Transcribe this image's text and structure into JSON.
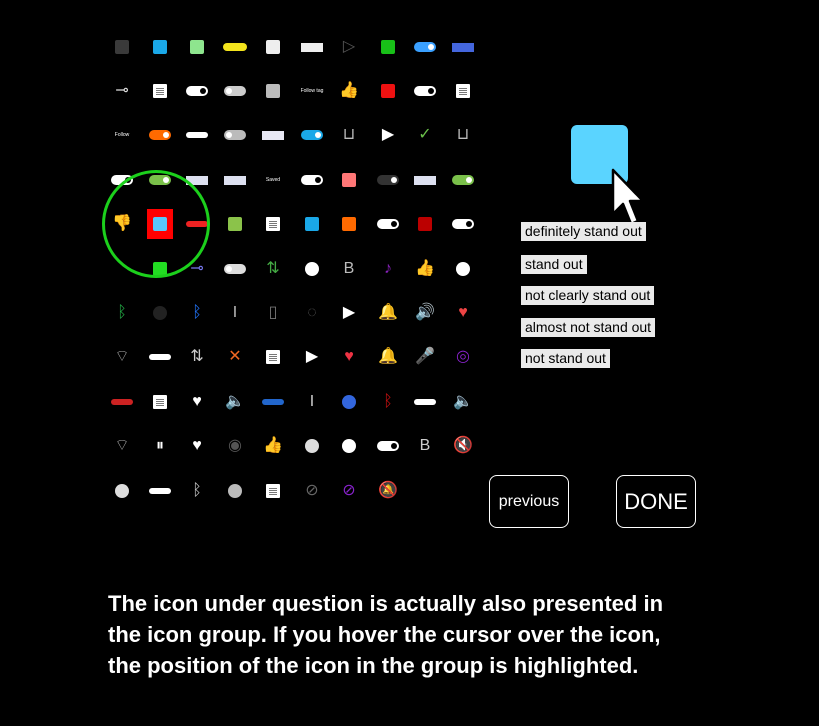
{
  "screen": {
    "target_icon_name": "light-blue-square-icon",
    "options": [
      {
        "label": "definitely stand out"
      },
      {
        "label": "stand out"
      },
      {
        "label": "not clearly stand out"
      },
      {
        "label": "almost not stand out"
      },
      {
        "label": "not stand out"
      }
    ],
    "previous_label": "previous",
    "done_label": "DONE",
    "instructions": [
      "The icon under question is actually also presented in",
      "the icon group. If you hover the cursor over the icon,",
      "the position of the icon in the group is highlighted."
    ],
    "highlight_color": "#1cd01c",
    "highlight_box_color": "#ff0000",
    "target_color": "#5ad4ff"
  },
  "icon_grid": {
    "rows": [
      [
        {
          "name": "dark-gray-square-icon",
          "kind": "sq",
          "color": "#3a3a3a"
        },
        {
          "name": "blue-square-icon",
          "kind": "sq",
          "color": "#1aa8e8"
        },
        {
          "name": "light-green-square-icon",
          "kind": "sq",
          "color": "#8ee58e"
        },
        {
          "name": "yellow-pill-icon",
          "kind": "pill",
          "color": "#f4e41c"
        },
        {
          "name": "white-square-icon",
          "kind": "sq",
          "color": "#eeeeee"
        },
        {
          "name": "white-label-bar-icon",
          "kind": "rect",
          "color": "#eeeeee"
        },
        {
          "name": "play-outline-icon",
          "kind": "glyph",
          "text": "▷",
          "color": "#555555"
        },
        {
          "name": "green-square-icon",
          "kind": "sq",
          "color": "#18c018"
        },
        {
          "name": "blue-toggle-icon",
          "kind": "tog",
          "color": "#3aa0ff",
          "knob": "r"
        },
        {
          "name": "blue-white-bar-icon",
          "kind": "rect",
          "color": "#4466dd"
        }
      ],
      [
        {
          "name": "slider-knob-icon",
          "kind": "glyph",
          "text": "⊸",
          "color": "#dddddd"
        },
        {
          "name": "document-icon",
          "kind": "doc"
        },
        {
          "name": "white-toggle-icon",
          "kind": "tog",
          "color": "#ffffff",
          "knob": "dr"
        },
        {
          "name": "gray-toggle-icon",
          "kind": "tog",
          "color": "#cccccc",
          "knob": "l"
        },
        {
          "name": "gray-square-icon",
          "kind": "sq",
          "color": "#bbbbbb"
        },
        {
          "name": "small-text-label-icon",
          "kind": "text",
          "text": "Follow tag"
        },
        {
          "name": "thumbs-up-icon",
          "kind": "glyph",
          "text": "👍",
          "color": "#ffffff"
        },
        {
          "name": "red-square-icon",
          "kind": "sq",
          "color": "#ee1111"
        },
        {
          "name": "dark-toggle-icon",
          "kind": "tog",
          "color": "#ffffff",
          "knob": "dr"
        },
        {
          "name": "document-icon",
          "kind": "doc"
        }
      ],
      [
        {
          "name": "small-text-label-icon",
          "kind": "text",
          "text": "Follow"
        },
        {
          "name": "orange-toggle-icon",
          "kind": "tog",
          "color": "#ff6a00",
          "knob": "r"
        },
        {
          "name": "white-blue-bar-icon",
          "kind": "btnbar",
          "color": "#ffffff"
        },
        {
          "name": "gray-toggle-icon",
          "kind": "tog",
          "color": "#bbbbbb",
          "knob": "l"
        },
        {
          "name": "white-blue-bar-icon",
          "kind": "rect",
          "color": "#e8e8f4"
        },
        {
          "name": "blue-toggle-icon",
          "kind": "tog",
          "color": "#1aa8e8",
          "knob": "r"
        },
        {
          "name": "u-box-icon",
          "kind": "glyph",
          "text": "⊔",
          "color": "#bbbbbb"
        },
        {
          "name": "play-icon",
          "kind": "glyph",
          "text": "▶",
          "color": "#ffffff"
        },
        {
          "name": "checkmark-icon",
          "kind": "glyph",
          "text": "✓",
          "color": "#6ac04a"
        },
        {
          "name": "u-box-icon",
          "kind": "glyph",
          "text": "⊔",
          "color": "#bbbbbb"
        }
      ],
      [
        {
          "name": "white-toggle-icon",
          "kind": "tog",
          "color": "#ffffff",
          "knob": "dr"
        },
        {
          "name": "green-toggle-icon",
          "kind": "tog",
          "color": "#7ac04a",
          "knob": "r"
        },
        {
          "name": "white-blue-bar-icon",
          "kind": "rect",
          "color": "#dde0f0"
        },
        {
          "name": "white-blue-bar-icon",
          "kind": "rect",
          "color": "#dde0f0"
        },
        {
          "name": "small-text-label-icon",
          "kind": "text",
          "text": "Saved"
        },
        {
          "name": "white-toggle-icon",
          "kind": "tog",
          "color": "#ffffff",
          "knob": "dr"
        },
        {
          "name": "pink-square-icon",
          "kind": "sq",
          "color": "#ff7777"
        },
        {
          "name": "dark-toggle-icon",
          "kind": "tog",
          "color": "#333333",
          "knob": "r"
        },
        {
          "name": "white-blue-bar-icon",
          "kind": "rect",
          "color": "#dde0f0"
        },
        {
          "name": "green-toggle-icon",
          "kind": "tog",
          "color": "#7ac04a",
          "knob": "r"
        }
      ],
      [
        {
          "name": "thumbs-down-icon",
          "kind": "glyph",
          "text": "👎",
          "color": "#ffffff"
        },
        {
          "name": "light-blue-square-icon",
          "kind": "highlight"
        },
        {
          "name": "red-label-bar-icon",
          "kind": "btnbar",
          "color": "#ee2222"
        },
        {
          "name": "green-square-icon",
          "kind": "sq",
          "color": "#8bc34a"
        },
        {
          "name": "document-icon",
          "kind": "doc"
        },
        {
          "name": "blue-square-icon",
          "kind": "sq",
          "color": "#1aa8e8"
        },
        {
          "name": "orange-square-icon",
          "kind": "sq",
          "color": "#ff6a00"
        },
        {
          "name": "white-toggle-icon",
          "kind": "tog",
          "color": "#ffffff",
          "knob": "dr"
        },
        {
          "name": "dark-red-square-icon",
          "kind": "sq",
          "color": "#bb0000"
        },
        {
          "name": "white-toggle-icon",
          "kind": "tog",
          "color": "#ffffff",
          "knob": "dr"
        }
      ],
      [
        {
          "name": "blank-icon",
          "kind": "empty"
        },
        {
          "name": "green-square-icon",
          "kind": "sq",
          "color": "#22dd22"
        },
        {
          "name": "slider-icon",
          "kind": "glyph",
          "text": "⊸",
          "color": "#7777ee"
        },
        {
          "name": "gray-toggle-icon",
          "kind": "tog",
          "color": "#dddddd",
          "knob": "l"
        },
        {
          "name": "sync-icon",
          "kind": "glyph",
          "text": "⇅",
          "color": "#44aa44"
        },
        {
          "name": "info-circle-icon",
          "kind": "dot",
          "color": "#ffffff"
        },
        {
          "name": "b-box-icon",
          "kind": "glyph",
          "text": "B",
          "color": "#bbbbbb"
        },
        {
          "name": "mic-off-icon",
          "kind": "glyph",
          "text": "♪",
          "color": "#8822bb"
        },
        {
          "name": "thumbs-up-icon",
          "kind": "glyph",
          "text": "👍",
          "color": "#ffffff"
        },
        {
          "name": "white-circle-icon",
          "kind": "dot",
          "color": "#ffffff"
        }
      ],
      [
        {
          "name": "bluetooth-icon",
          "kind": "glyph",
          "text": "ᛒ",
          "color": "#22aa44"
        },
        {
          "name": "info-dot-icon",
          "kind": "dot",
          "color": "#222222"
        },
        {
          "name": "bluetooth-icon",
          "kind": "glyph",
          "text": "ᛒ",
          "color": "#2277ff"
        },
        {
          "name": "italic-box-icon",
          "kind": "glyph",
          "text": "I",
          "color": "#bbbbbb"
        },
        {
          "name": "columns-icon",
          "kind": "glyph",
          "text": "▯",
          "color": "#777777"
        },
        {
          "name": "bell-outline-icon",
          "kind": "glyph",
          "text": "◌",
          "color": "#555555"
        },
        {
          "name": "play-circle-icon",
          "kind": "glyph",
          "text": "▶",
          "color": "#ffffff"
        },
        {
          "name": "bell-icon",
          "kind": "glyph",
          "text": "🔔",
          "color": "#ffffff"
        },
        {
          "name": "volume-icon",
          "kind": "glyph",
          "text": "🔊",
          "color": "#cccccc"
        },
        {
          "name": "heart-icon",
          "kind": "glyph",
          "text": "♥",
          "color": "#ee4444"
        }
      ],
      [
        {
          "name": "wifi-icon",
          "kind": "glyph",
          "text": "⌔",
          "color": "#aaaaaa"
        },
        {
          "name": "white-label-bar-icon",
          "kind": "btnbar",
          "color": "#ffffff"
        },
        {
          "name": "sync-icon",
          "kind": "glyph",
          "text": "⇅",
          "color": "#cccccc"
        },
        {
          "name": "close-icon",
          "kind": "glyph",
          "text": "✕",
          "color": "#ee6622"
        },
        {
          "name": "document-icon",
          "kind": "doc"
        },
        {
          "name": "play-circle-icon",
          "kind": "glyph",
          "text": "▶",
          "color": "#ffffff"
        },
        {
          "name": "heart-icon",
          "kind": "glyph",
          "text": "♥",
          "color": "#ee3344"
        },
        {
          "name": "bell-icon",
          "kind": "glyph",
          "text": "🔔",
          "color": "#ffffff"
        },
        {
          "name": "mic-icon",
          "kind": "glyph",
          "text": "🎤",
          "color": "#8822cc"
        },
        {
          "name": "mic-circle-icon",
          "kind": "glyph",
          "text": "◎",
          "color": "#8822cc"
        }
      ],
      [
        {
          "name": "red-save-button-icon",
          "kind": "btnbar",
          "color": "#cc2222"
        },
        {
          "name": "document-icon",
          "kind": "doc"
        },
        {
          "name": "heart-icon",
          "kind": "glyph",
          "text": "♥",
          "color": "#ffffff"
        },
        {
          "name": "volume-icon",
          "kind": "glyph",
          "text": "🔈",
          "color": "#3366cc"
        },
        {
          "name": "blue-label-bar-icon",
          "kind": "btnbar",
          "color": "#2266cc"
        },
        {
          "name": "italic-box-icon",
          "kind": "glyph",
          "text": "I",
          "color": "#cccccc"
        },
        {
          "name": "blue-circle-icon",
          "kind": "dot",
          "color": "#3366dd"
        },
        {
          "name": "bluetooth-icon",
          "kind": "glyph",
          "text": "ᛒ",
          "color": "#cc1111"
        },
        {
          "name": "white-label-bar-icon",
          "kind": "btnbar",
          "color": "#ffffff"
        },
        {
          "name": "volume-icon",
          "kind": "glyph",
          "text": "🔈",
          "color": "#ffffff"
        }
      ],
      [
        {
          "name": "wifi-icon",
          "kind": "glyph",
          "text": "⌔",
          "color": "#aaaaaa"
        },
        {
          "name": "pause-icon",
          "kind": "glyph",
          "text": "⏸",
          "color": "#ffffff"
        },
        {
          "name": "heart-icon",
          "kind": "glyph",
          "text": "♥",
          "color": "#ffffff"
        },
        {
          "name": "eye-icon",
          "kind": "glyph",
          "text": "◉",
          "color": "#555555"
        },
        {
          "name": "thumbs-up-icon",
          "kind": "glyph",
          "text": "👍",
          "color": "#3399dd"
        },
        {
          "name": "heart-circle-icon",
          "kind": "dot",
          "color": "#dddddd"
        },
        {
          "name": "white-circle-icon",
          "kind": "dot",
          "color": "#ffffff"
        },
        {
          "name": "dark-toggle-icon",
          "kind": "tog",
          "color": "#ffffff",
          "knob": "dr"
        },
        {
          "name": "b-box-icon",
          "kind": "glyph",
          "text": "B",
          "color": "#cccccc"
        },
        {
          "name": "volume-mute-icon",
          "kind": "glyph",
          "text": "🔇",
          "color": "#5577cc"
        }
      ],
      [
        {
          "name": "heart-circle-icon",
          "kind": "dot",
          "color": "#dddddd"
        },
        {
          "name": "white-label-bar-icon",
          "kind": "btnbar",
          "color": "#ffffff"
        },
        {
          "name": "bluetooth-icon",
          "kind": "glyph",
          "text": "ᛒ",
          "color": "#cccccc"
        },
        {
          "name": "gray-circle-icon",
          "kind": "dot",
          "color": "#bbbbbb"
        },
        {
          "name": "document-icon",
          "kind": "doc"
        },
        {
          "name": "eye-off-icon",
          "kind": "glyph",
          "text": "⊘",
          "color": "#666666"
        },
        {
          "name": "mic-off-icon",
          "kind": "glyph",
          "text": "⊘",
          "color": "#8822cc"
        },
        {
          "name": "bell-off-icon",
          "kind": "glyph",
          "text": "🔕",
          "color": "#ffffff"
        }
      ]
    ]
  }
}
